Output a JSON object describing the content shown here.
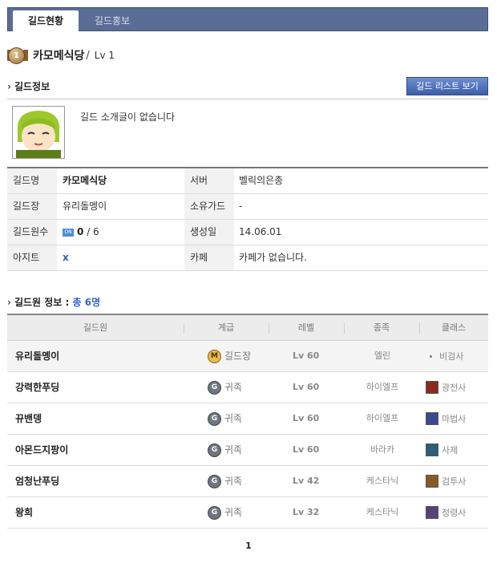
{
  "tabs": [
    {
      "label": "길드현황",
      "active": true
    },
    {
      "label": "길드홍보",
      "active": false
    }
  ],
  "guild": {
    "rank_badge": "1",
    "name": "카모메식당",
    "separator": "/",
    "level": "Lv 1"
  },
  "guild_info": {
    "section_title": "길드정보",
    "list_button": "길드 리스트 보기",
    "intro": "길드 소개글이 없습니다",
    "rows": [
      {
        "k1": "길드명",
        "v1": "카모메식당",
        "k2": "서버",
        "v2": "벨릭의은총"
      },
      {
        "k1": "길드장",
        "v1": "유리돌멩이",
        "k2": "소유가드",
        "v2": "-"
      },
      {
        "k1": "길드원수",
        "on_badge": "ON",
        "online": "0",
        "total": "/ 6",
        "k2": "생성일",
        "v2": "14.06.01"
      },
      {
        "k1": "아지트",
        "v1": "x",
        "k2": "카페",
        "v2": "카페가 없습니다."
      }
    ]
  },
  "members": {
    "section_title": "길드원 정보 :",
    "count_text": "총 6명",
    "headers": [
      "길드원",
      "계급",
      "레벨",
      "종족",
      "클래스"
    ],
    "rows": [
      {
        "name": "유리돌멩이",
        "rank_icon": "M",
        "rank": "길드장",
        "level": "Lv 60",
        "race": "엘린",
        "class": "비검사",
        "class_icon": "none"
      },
      {
        "name": "강력한푸딩",
        "rank_icon": "G",
        "rank": "귀족",
        "level": "Lv 60",
        "race": "하이엘프",
        "class": "광전사",
        "class_icon": "#8b2a1c"
      },
      {
        "name": "뀨밴뎅",
        "rank_icon": "G",
        "rank": "귀족",
        "level": "Lv 60",
        "race": "하이엘프",
        "class": "마법사",
        "class_icon": "#3b4a8f"
      },
      {
        "name": "아몬드지팡이",
        "rank_icon": "G",
        "rank": "귀족",
        "level": "Lv 60",
        "race": "바라카",
        "class": "사제",
        "class_icon": "#2c5d7a"
      },
      {
        "name": "엄청난푸딩",
        "rank_icon": "G",
        "rank": "귀족",
        "level": "Lv 42",
        "race": "케스타닉",
        "class": "검투사",
        "class_icon": "#8a5a22"
      },
      {
        "name": "왕희",
        "rank_icon": "G",
        "rank": "귀족",
        "level": "Lv 32",
        "race": "케스타닉",
        "class": "정령사",
        "class_icon": "#5a3f7a"
      }
    ]
  },
  "pagination": {
    "current": "1"
  }
}
